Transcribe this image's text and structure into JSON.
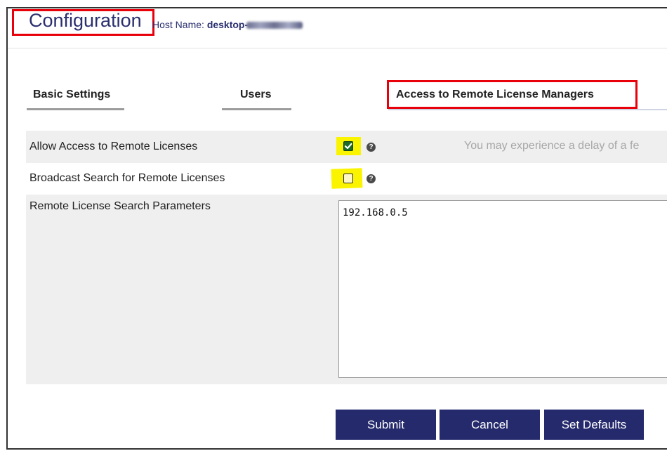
{
  "header": {
    "title": "Configuration",
    "host_label": "Host Name:",
    "host_value": "desktop-"
  },
  "tabs": [
    {
      "label": "Basic Settings"
    },
    {
      "label": "Users"
    },
    {
      "label": "Access to Remote License Managers",
      "active": true
    }
  ],
  "settings": {
    "allow_access": {
      "label": "Allow Access to Remote Licenses",
      "checked": true,
      "note": "You may experience a delay of a fe"
    },
    "broadcast_search": {
      "label": "Broadcast Search for Remote Licenses",
      "checked": false
    },
    "search_params": {
      "label": "Remote License Search Parameters",
      "value": "192.168.0.5"
    }
  },
  "icons": {
    "help": "?"
  },
  "buttons": {
    "submit": "Submit",
    "cancel": "Cancel",
    "set_defaults": "Set Defaults"
  },
  "colors": {
    "accent": "#252a6c",
    "title": "#2a2f6e",
    "highlight_red": "#e8000b",
    "highlight_yellow": "#fbf400",
    "checkbox_checked": "#1d6a2a"
  }
}
